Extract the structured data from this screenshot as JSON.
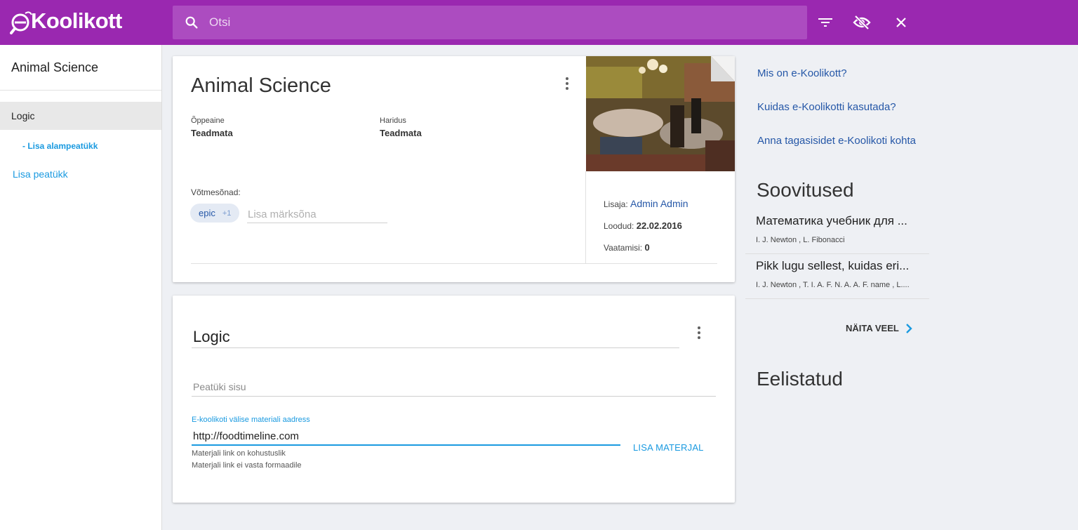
{
  "app": {
    "logo_text": "Koolikott",
    "brand_color": "#9a28b0",
    "accent_color": "#1a9ae0",
    "link_color": "#2557a7"
  },
  "search": {
    "placeholder": "Otsi",
    "icon": "search-icon"
  },
  "toolbar": {
    "filter_icon": "filter-icon",
    "visibility_icon": "visibility-off-icon",
    "close_icon": "close-icon"
  },
  "sidebar": {
    "title": "Animal Science",
    "active_item": "Logic",
    "sub_link": "- Lisa alampeatükk",
    "add_chapter": "Lisa peatükk"
  },
  "material": {
    "title": "Animal Science",
    "subject_label": "Õppeaine",
    "subject_value": "Teadmata",
    "education_label": "Haridus",
    "education_value": "Teadmata",
    "keywords_label": "Võtmesõnad:",
    "keyword_chip": "epic",
    "keyword_more": "+1",
    "keyword_placeholder": "Lisa märksõna",
    "added_by_label": "Lisaja:",
    "added_by": "Admin Admin",
    "created_label": "Loodud:",
    "created": "22.02.2016",
    "views_label": "Vaatamisi:",
    "views": "0"
  },
  "chapter": {
    "title": "Logic",
    "content_placeholder": "Peatüki sisu",
    "url_label": "E-koolikoti välise materiali aadress",
    "url_value": "http://foodtimeline.com",
    "error_required": "Materjali link on kohustuslik",
    "error_format": "Materjali link ei vasta formaadile",
    "add_button": "LISA MATERJAL"
  },
  "right": {
    "links": [
      "Mis on e-Koolikott?",
      "Kuidas e-Koolikotti kasutada?",
      "Anna tagasisidet e-Koolikoti kohta"
    ],
    "recommendations_heading": "Soovitused",
    "recommendations": [
      {
        "title": "Математика учебник для ...",
        "authors": "I. J. Newton , L. Fibonacci"
      },
      {
        "title": "Pikk lugu sellest, kuidas eri...",
        "authors": "I. J. Newton , T. I. A. F. N. A. A. F. name , L...."
      }
    ],
    "show_more": "NÄITA VEEL",
    "favorites_heading": "Eelistatud"
  }
}
